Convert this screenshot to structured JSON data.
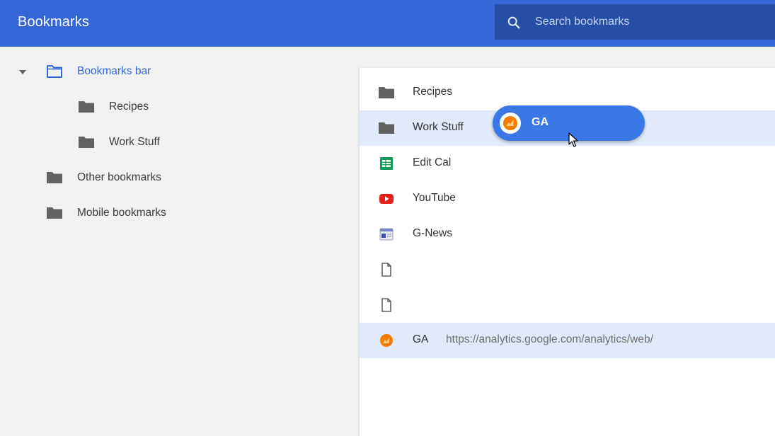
{
  "app": {
    "title": "Bookmarks"
  },
  "search": {
    "placeholder": "Search bookmarks"
  },
  "sidebar": {
    "items": [
      {
        "label": "Bookmarks bar",
        "expanded": true,
        "selected": true,
        "icon": "folder-outline-icon"
      },
      {
        "label": "Recipes",
        "icon": "folder-icon"
      },
      {
        "label": "Work Stuff",
        "icon": "folder-icon"
      },
      {
        "label": "Other bookmarks",
        "icon": "folder-icon"
      },
      {
        "label": "Mobile bookmarks",
        "icon": "folder-icon"
      }
    ]
  },
  "list": {
    "rows": [
      {
        "title": "Recipes",
        "url": "",
        "icon": "folder-icon"
      },
      {
        "title": "Work Stuff",
        "url": "",
        "icon": "folder-icon",
        "highlighted": true
      },
      {
        "title": "Edit Cal",
        "url": "",
        "icon": "sheets-icon"
      },
      {
        "title": "YouTube",
        "url": "",
        "icon": "youtube-icon"
      },
      {
        "title": "G-News",
        "url": "",
        "icon": "news-icon"
      },
      {
        "title": "",
        "url": "",
        "icon": "page-icon"
      },
      {
        "title": "",
        "url": "",
        "icon": "page-icon"
      },
      {
        "title": "GA",
        "url": "https://analytics.google.com/analytics/web/",
        "icon": "analytics-icon",
        "selected": true
      }
    ]
  },
  "drag": {
    "label": "GA",
    "icon": "analytics-icon"
  },
  "colors": {
    "accent": "#3367d6",
    "search_bg": "#254ea6",
    "selected_row": "#e1eaf9",
    "drag_chip": "#3b78e7"
  }
}
